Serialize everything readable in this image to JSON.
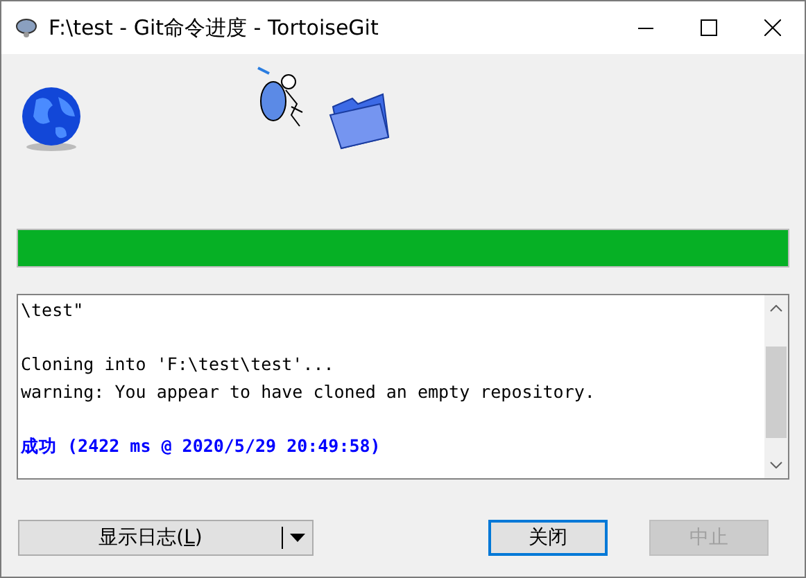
{
  "window": {
    "title": "F:\\test - Git命令进度 - TortoiseGit"
  },
  "progress": {
    "level": 1
  },
  "log": {
    "lines": [
      {
        "kind": "output",
        "text": "\\test\""
      },
      {
        "kind": "blank"
      },
      {
        "kind": "output",
        "text": "Cloning into 'F:\\test\\test'..."
      },
      {
        "kind": "output",
        "text": "warning: You appear to have cloned an empty repository."
      },
      {
        "kind": "blank"
      },
      {
        "kind": "success",
        "text": "成功 (2422 ms @ 2020/5/29 20:49:58)"
      }
    ]
  },
  "buttons": {
    "show_log": {
      "label_before": "显示日志(",
      "access_key": "L",
      "label_after": ")"
    },
    "close": {
      "label": "关闭",
      "default": true,
      "disabled": false
    },
    "abort": {
      "label": "中止",
      "default": false,
      "disabled": true
    }
  }
}
